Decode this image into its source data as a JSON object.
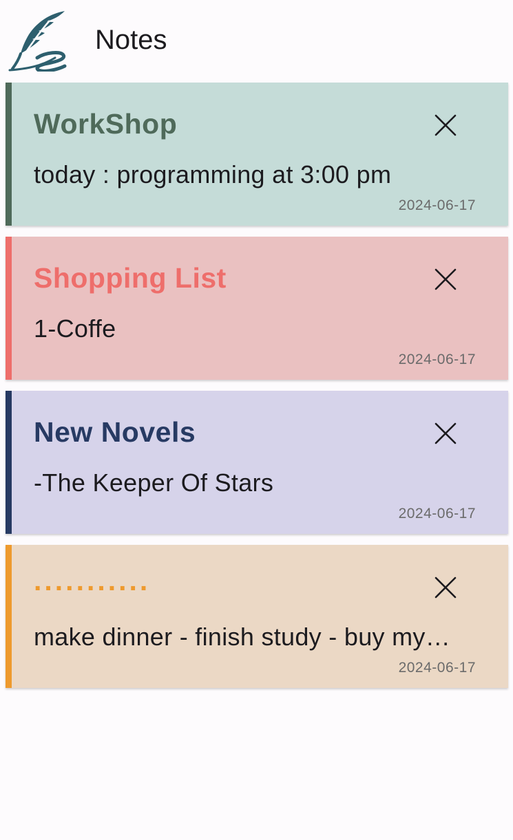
{
  "app": {
    "title": "Notes",
    "logo_icon": "quill-s-logo-icon",
    "logo_color": "#2e5f6e"
  },
  "notes": [
    {
      "title": "WorkShop",
      "body": "today : programming at 3:00 pm",
      "date": "2024-06-17",
      "background": "#c5dcd8",
      "accent": "#4f6a5a",
      "title_color": "#4f6a5a",
      "delete_icon": "close-icon"
    },
    {
      "title": "Shopping List",
      "body": "1-Coffe",
      "date": "2024-06-17",
      "background": "#eac1c1",
      "accent": "#ee6e6b",
      "title_color": "#ee6e6b",
      "delete_icon": "close-icon"
    },
    {
      "title": "New Novels",
      "body": "-The Keeper Of Stars",
      "date": "2024-06-17",
      "background": "#d6d3ea",
      "accent": "#273a63",
      "title_color": "#273a63",
      "delete_icon": "close-icon"
    },
    {
      "title": "...........",
      "body": "make dinner - finish study - buy my…",
      "date": "2024-06-17",
      "background": "#ebd8c5",
      "accent": "#ee9a2e",
      "title_color": "#ee9a2e",
      "delete_icon": "close-icon"
    }
  ]
}
